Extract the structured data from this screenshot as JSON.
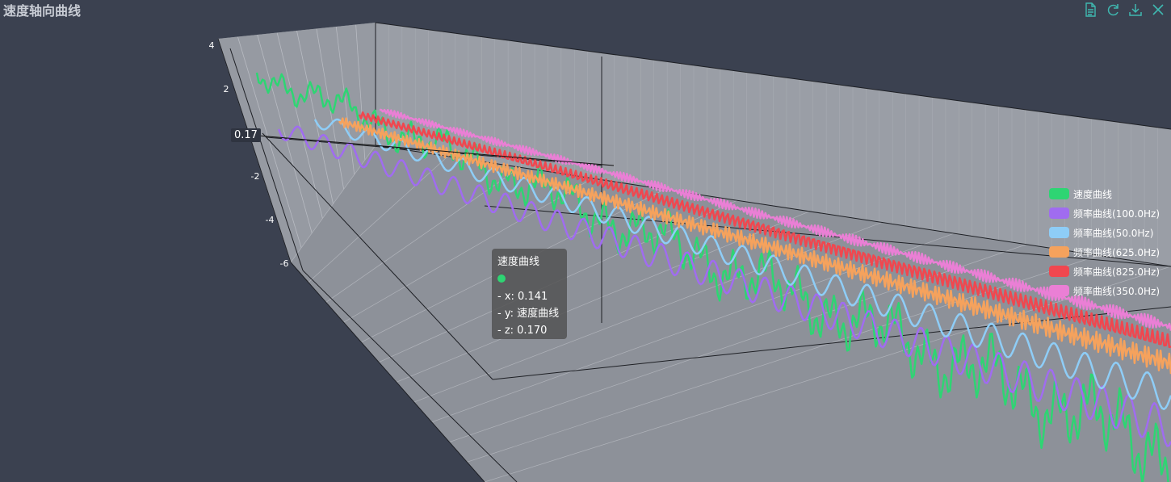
{
  "title": "速度轴向曲线",
  "toolbox": [
    "data-view-icon",
    "restore-icon",
    "save-image-icon",
    "close-icon"
  ],
  "axis_pointer_label": "0.17",
  "tooltip": {
    "series": "速度曲线",
    "lines": [
      "- x: 0.141",
      "- y: 速度曲线",
      "- z: 0.170"
    ],
    "color": "#2ed573"
  },
  "chart_data": {
    "type": "line",
    "title": "速度轴向曲线",
    "z_ticks": [
      "4",
      "2",
      "0",
      "-2",
      "-4",
      "-6"
    ],
    "zlim": [
      -6,
      4
    ],
    "grid": true,
    "legend_position": "right",
    "series": [
      {
        "name": "速度曲线",
        "color": "#2ed573"
      },
      {
        "name": "频率曲线(100.0Hz)",
        "color": "#a06cf0"
      },
      {
        "name": "频率曲线(50.0Hz)",
        "color": "#8ecdf7"
      },
      {
        "name": "频率曲线(625.0Hz)",
        "color": "#f5a25d"
      },
      {
        "name": "频率曲线(825.0Hz)",
        "color": "#f0474f"
      },
      {
        "name": "频率曲线(350.0Hz)",
        "color": "#ea7fd5"
      }
    ]
  }
}
